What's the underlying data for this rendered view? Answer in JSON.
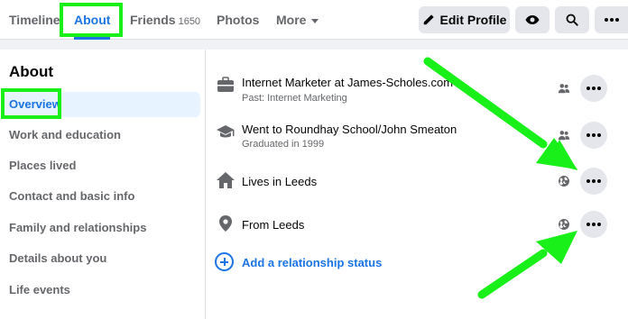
{
  "nav": {
    "tabs": [
      {
        "label": "Timeline"
      },
      {
        "label": "About"
      },
      {
        "label": "Friends",
        "count": "1650"
      },
      {
        "label": "Photos"
      },
      {
        "label": "More"
      }
    ],
    "edit_profile_label": "Edit Profile",
    "buttons": [
      "eye-icon",
      "search-icon",
      "more-icon"
    ]
  },
  "sidebar": {
    "title": "About",
    "items": [
      {
        "label": "Overview"
      },
      {
        "label": "Work and education"
      },
      {
        "label": "Places lived"
      },
      {
        "label": "Contact and basic info"
      },
      {
        "label": "Family and relationships"
      },
      {
        "label": "Details about you"
      },
      {
        "label": "Life events"
      }
    ]
  },
  "overview": {
    "rows": [
      {
        "icon": "briefcase-icon",
        "title": "Internet Marketer at James-Scholes.com",
        "subtitle": "Past: Internet Marketing",
        "audience": "friends-icon"
      },
      {
        "icon": "graduation-cap-icon",
        "title": "Went to Roundhay School/John Smeaton",
        "subtitle": "Graduated in 1999",
        "audience": "friends-icon"
      },
      {
        "icon": "home-icon",
        "title": "Lives in Leeds",
        "subtitle": "",
        "audience": "globe-icon"
      },
      {
        "icon": "location-pin-icon",
        "title": "From Leeds",
        "subtitle": "",
        "audience": "globe-icon"
      }
    ],
    "add_relationship_label": "Add a relationship status"
  },
  "colors": {
    "accent": "#1b74e4",
    "annotation": "#19f019",
    "active_bg": "#e7f3ff"
  }
}
